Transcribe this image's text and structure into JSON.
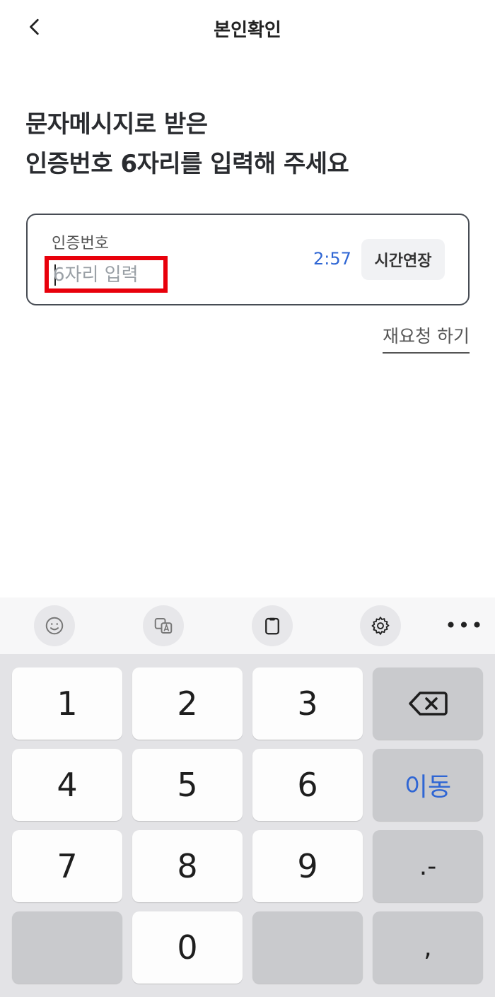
{
  "header": {
    "title": "본인확인",
    "back_icon": "chevron-left-icon"
  },
  "heading": {
    "line1": "문자메시지로 받은",
    "line2": "인증번호 6자리를 입력해 주세요"
  },
  "code_field": {
    "label": "인증번호",
    "placeholder": "6자리 입력",
    "value": "",
    "timer": "2:57",
    "extend_label": "시간연장"
  },
  "resend_label": "재요청 하기",
  "keyboard": {
    "toolbar": [
      "emoji-icon",
      "translate-icon",
      "clipboard-icon",
      "settings-icon",
      "more-icon"
    ],
    "keys": {
      "k1": "1",
      "k2": "2",
      "k3": "3",
      "k4": "4",
      "k5": "5",
      "k6": "6",
      "k7": "7",
      "k8": "8",
      "k9": "9",
      "k0": "0",
      "move": "이동",
      "dot_dash": ".-",
      "comma": ","
    }
  },
  "colors": {
    "accent_blue": "#2f66d4",
    "highlight_red": "#e8000b",
    "border_dark": "#474c54"
  }
}
